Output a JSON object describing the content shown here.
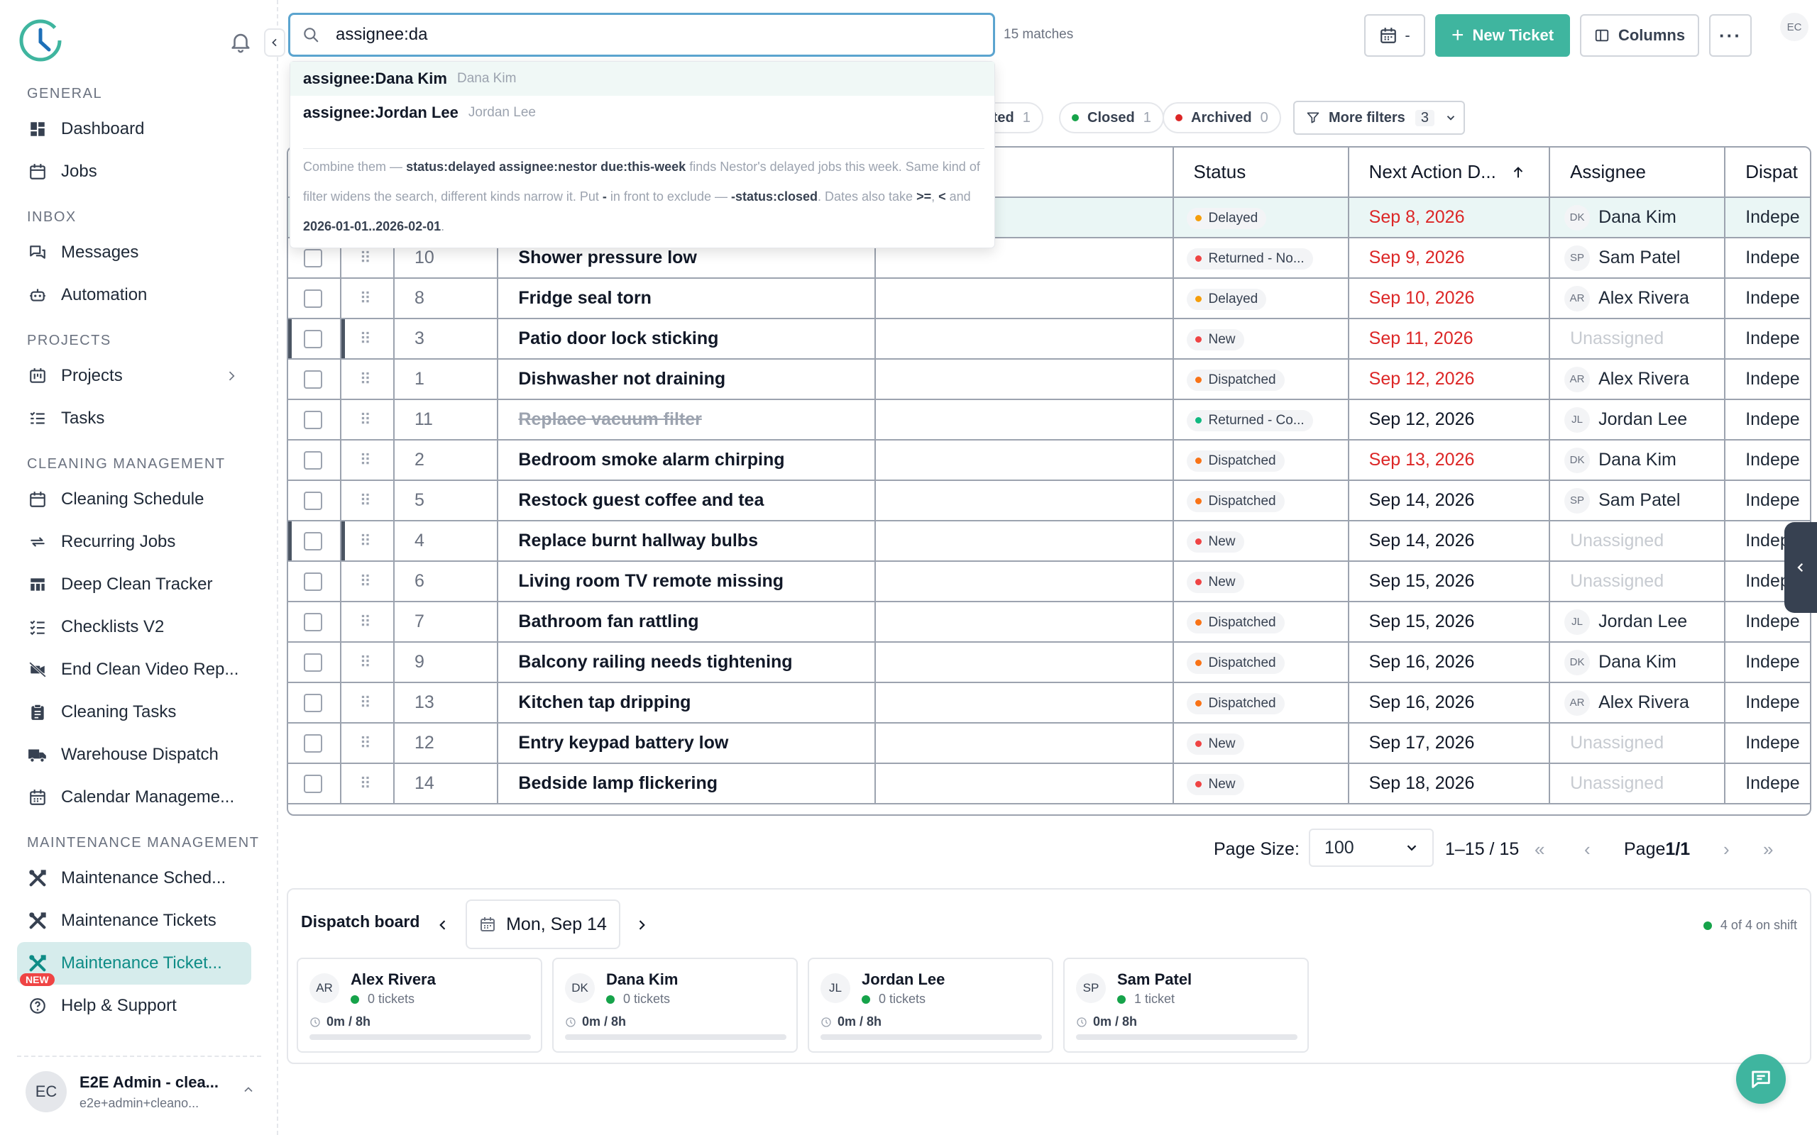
{
  "search": {
    "value": "assignee:da",
    "matches": "15 matches"
  },
  "suggestions": [
    {
      "key": "assignee:Dana Kim",
      "name": "Dana Kim"
    },
    {
      "key": "assignee:Jordan Lee",
      "name": "Jordan Lee"
    }
  ],
  "hint": {
    "p1": "Combine them — ",
    "c1": "status:delayed assignee:nestor due:this-week",
    "p2": " finds Nestor's delayed jobs this week. Same kind of filter widens the search, different kinds narrow it. Put ",
    "c2": "-",
    "p3": " in front to exclude — ",
    "c3": "-status:closed",
    "p4": ". Dates also take ",
    "c4": ">=",
    "p5": ", ",
    "c5": "<",
    "p6": " and ",
    "c6": "2026-01-01..2026-02-01",
    "p7": "."
  },
  "toolbar": {
    "date_label": "-",
    "new_ticket": "New Ticket",
    "columns": "Columns",
    "user_initials": "EC"
  },
  "chips": [
    {
      "label": "leted",
      "count": "1",
      "color": ""
    },
    {
      "label": "Closed",
      "count": "1",
      "color": "#16a34a"
    },
    {
      "label": "Archived",
      "count": "0",
      "color": "#dc2626"
    }
  ],
  "more_filters": {
    "label": "More filters",
    "count": "3"
  },
  "sidebar": {
    "sections": {
      "general": "GENERAL",
      "inbox": "INBOX",
      "projects": "PROJECTS",
      "cleaning": "CLEANING MANAGEMENT",
      "maintenance": "MAINTENANCE MANAGEMENT"
    },
    "items": {
      "dashboard": "Dashboard",
      "jobs": "Jobs",
      "messages": "Messages",
      "automation": "Automation",
      "projects": "Projects",
      "tasks": "Tasks",
      "cleaning_schedule": "Cleaning Schedule",
      "recurring_jobs": "Recurring Jobs",
      "deep_clean": "Deep Clean Tracker",
      "checklists": "Checklists V2",
      "end_clean": "End Clean Video Rep...",
      "cleaning_tasks": "Cleaning Tasks",
      "warehouse": "Warehouse Dispatch",
      "calendar": "Calendar Manageme...",
      "maint_sched": "Maintenance Sched...",
      "maint_tickets": "Maintenance Tickets",
      "maint_tickets_new": "Maintenance Ticket...",
      "help": "Help & Support"
    },
    "new_badge": "NEW",
    "user": {
      "initials": "EC",
      "name": "E2E Admin - clea...",
      "email": "e2e+admin+cleano..."
    }
  },
  "table": {
    "headers": {
      "status": "Status",
      "next_action": "Next Action D...",
      "assignee": "Assignee",
      "dispatch": "Dispat"
    },
    "rows": [
      {
        "num": "",
        "title": "",
        "status": "Delayed",
        "status_color": "#f59e0b",
        "date": "Sep 8, 2026",
        "overdue": true,
        "initials": "DK",
        "assignee": "Dana Kim",
        "dispatch": "Indepe",
        "hl": true
      },
      {
        "num": "10",
        "title": "Shower pressure low",
        "status": "Returned - No...",
        "status_color": "#ef4444",
        "date": "Sep 9, 2026",
        "overdue": true,
        "initials": "SP",
        "assignee": "Sam Patel",
        "dispatch": "Indepe"
      },
      {
        "num": "8",
        "title": "Fridge seal torn",
        "status": "Delayed",
        "status_color": "#f59e0b",
        "date": "Sep 10, 2026",
        "overdue": true,
        "initials": "AR",
        "assignee": "Alex Rivera",
        "dispatch": "Indepe"
      },
      {
        "num": "3",
        "title": "Patio door lock sticking",
        "status": "New",
        "status_color": "#ef4444",
        "date": "Sep 11, 2026",
        "overdue": true,
        "initials": "",
        "assignee": "Unassigned",
        "dispatch": "Indepe",
        "mark": true
      },
      {
        "num": "1",
        "title": "Dishwasher not draining",
        "status": "Dispatched",
        "status_color": "#f97316",
        "date": "Sep 12, 2026",
        "overdue": true,
        "initials": "AR",
        "assignee": "Alex Rivera",
        "dispatch": "Indepe"
      },
      {
        "num": "11",
        "title": "Replace vacuum filter",
        "status": "Returned - Co...",
        "status_color": "#10b981",
        "date": "Sep 12, 2026",
        "overdue": false,
        "initials": "JL",
        "assignee": "Jordan Lee",
        "dispatch": "Indepe",
        "strike": true
      },
      {
        "num": "2",
        "title": "Bedroom smoke alarm chirping",
        "status": "Dispatched",
        "status_color": "#f97316",
        "date": "Sep 13, 2026",
        "overdue": true,
        "initials": "DK",
        "assignee": "Dana Kim",
        "dispatch": "Indepe"
      },
      {
        "num": "5",
        "title": "Restock guest coffee and tea",
        "status": "Dispatched",
        "status_color": "#f97316",
        "date": "Sep 14, 2026",
        "overdue": false,
        "initials": "SP",
        "assignee": "Sam Patel",
        "dispatch": "Indepe"
      },
      {
        "num": "4",
        "title": "Replace burnt hallway bulbs",
        "status": "New",
        "status_color": "#ef4444",
        "date": "Sep 14, 2026",
        "overdue": false,
        "initials": "",
        "assignee": "Unassigned",
        "dispatch": "Indepe",
        "mark": true
      },
      {
        "num": "6",
        "title": "Living room TV remote missing",
        "status": "New",
        "status_color": "#ef4444",
        "date": "Sep 15, 2026",
        "overdue": false,
        "initials": "",
        "assignee": "Unassigned",
        "dispatch": "Indepe"
      },
      {
        "num": "7",
        "title": "Bathroom fan rattling",
        "status": "Dispatched",
        "status_color": "#f97316",
        "date": "Sep 15, 2026",
        "overdue": false,
        "initials": "JL",
        "assignee": "Jordan Lee",
        "dispatch": "Indepe"
      },
      {
        "num": "9",
        "title": "Balcony railing needs tightening",
        "status": "Dispatched",
        "status_color": "#f97316",
        "date": "Sep 16, 2026",
        "overdue": false,
        "initials": "DK",
        "assignee": "Dana Kim",
        "dispatch": "Indepe"
      },
      {
        "num": "13",
        "title": "Kitchen tap dripping",
        "status": "Dispatched",
        "status_color": "#f97316",
        "date": "Sep 16, 2026",
        "overdue": false,
        "initials": "AR",
        "assignee": "Alex Rivera",
        "dispatch": "Indepe"
      },
      {
        "num": "12",
        "title": "Entry keypad battery low",
        "status": "New",
        "status_color": "#ef4444",
        "date": "Sep 17, 2026",
        "overdue": false,
        "initials": "",
        "assignee": "Unassigned",
        "dispatch": "Indepe"
      },
      {
        "num": "14",
        "title": "Bedside lamp flickering",
        "status": "New",
        "status_color": "#ef4444",
        "date": "Sep 18, 2026",
        "overdue": false,
        "initials": "",
        "assignee": "Unassigned",
        "dispatch": "Indepe"
      }
    ]
  },
  "pagination": {
    "page_size_label": "Page Size:",
    "page_size": "100",
    "range": "1–15 / 15",
    "page_prefix": "Page ",
    "page": "1/1"
  },
  "dispatch": {
    "title": "Dispatch board",
    "date": "Mon, Sep 14",
    "on_shift": "4 of 4 on shift",
    "cards": [
      {
        "initials": "AR",
        "name": "Alex Rivera",
        "tickets": "0 tickets",
        "time": "0m / 8h"
      },
      {
        "initials": "DK",
        "name": "Dana Kim",
        "tickets": "0 tickets",
        "time": "0m / 8h"
      },
      {
        "initials": "JL",
        "name": "Jordan Lee",
        "tickets": "0 tickets",
        "time": "0m / 8h"
      },
      {
        "initials": "SP",
        "name": "Sam Patel",
        "tickets": "1 ticket",
        "time": "0m / 8h"
      }
    ]
  },
  "colors": {
    "accent": "#3fb59f",
    "overdue": "#dc2626",
    "focus": "#5ba4cf"
  }
}
